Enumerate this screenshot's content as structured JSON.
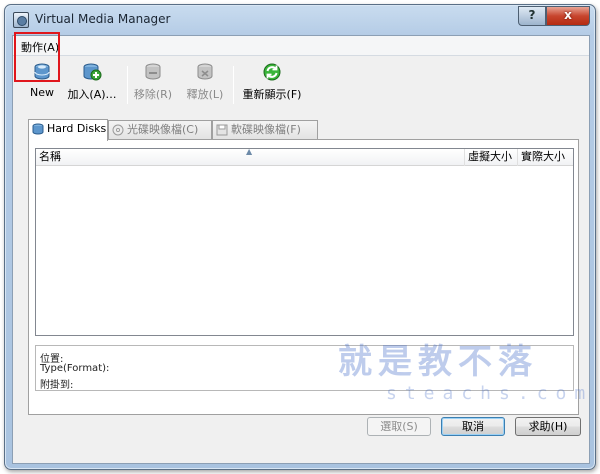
{
  "window": {
    "title": "Virtual Media Manager",
    "help_label": "?",
    "close_label": "x"
  },
  "menu": {
    "action": "動作(A)"
  },
  "toolbar": {
    "new": "New",
    "add": "加入(A)…",
    "remove": "移除(R)",
    "release": "釋放(L)",
    "refresh": "重新顯示(F)"
  },
  "tabs": {
    "hard_disks": "Hard Disks",
    "cd_images": "光碟映像檔(C)",
    "floppy_images": "軟碟映像檔(F)"
  },
  "list": {
    "columns": [
      "名稱",
      "虛擬大小",
      "實際大小"
    ],
    "rows": []
  },
  "info": {
    "location": "位置:",
    "type": "Type(Format):",
    "attached": "附掛到:"
  },
  "buttons": {
    "select": "選取(S)",
    "cancel": "取消",
    "help": "求助(H)"
  },
  "watermark": {
    "text": "就是教不落",
    "url": "steachs.com"
  },
  "colors": {
    "highlight": "#e0161c",
    "refresh_green": "#2aa52a"
  }
}
